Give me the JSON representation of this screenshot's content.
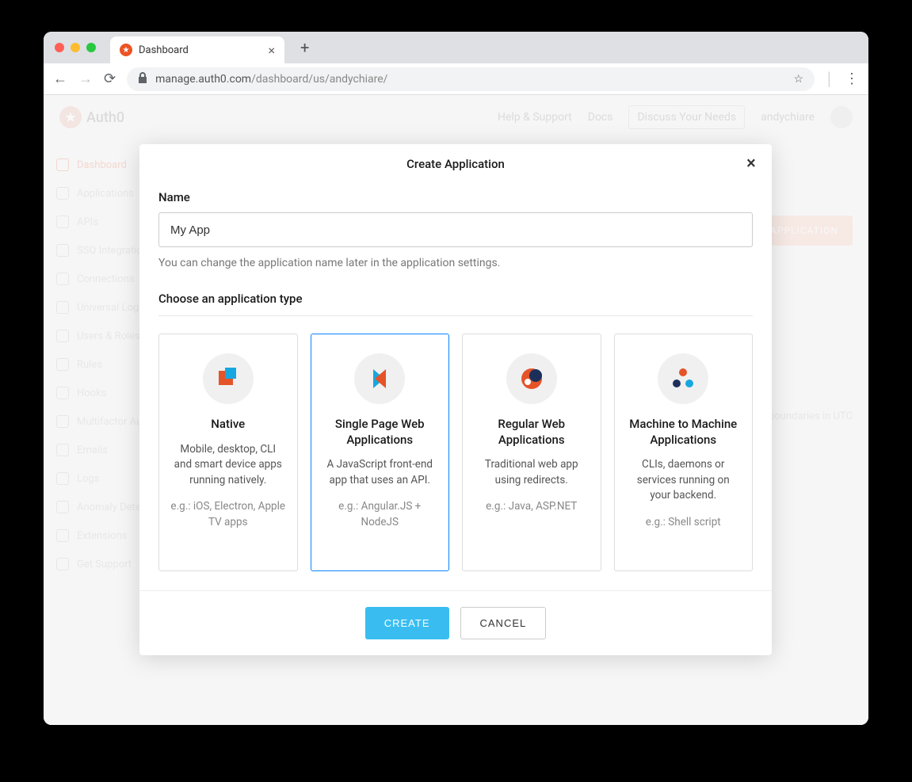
{
  "browser": {
    "tab_title": "Dashboard",
    "url_host": "manage.auth0.com",
    "url_path": "/dashboard/us/andychiare/"
  },
  "bg": {
    "brand": "Auth0",
    "nav": {
      "help": "Help & Support",
      "docs": "Docs",
      "discuss": "Discuss Your Needs",
      "user": "andychiare"
    },
    "sidebar": [
      "Dashboard",
      "Applications",
      "APIs",
      "SSO Integrations",
      "Connections",
      "Universal Login",
      "Users & Roles",
      "Rules",
      "Hooks",
      "Multifactor Auth",
      "Emails",
      "Logs",
      "Anomaly Detection",
      "Extensions",
      "Get Support"
    ],
    "create_app_btn": "+ CREATE APPLICATION",
    "utc_note": "boundaries in UTC"
  },
  "modal": {
    "title": "Create Application",
    "name_label": "Name",
    "name_value": "My App",
    "name_hint": "You can change the application name later in the application settings.",
    "type_label": "Choose an application type",
    "cards": [
      {
        "title": "Native",
        "desc": "Mobile, desktop, CLI and smart device apps running natively.",
        "eg": "e.g.: iOS, Electron, Apple TV apps",
        "selected": false
      },
      {
        "title": "Single Page Web Applications",
        "desc": "A JavaScript front-end app that uses an API.",
        "eg": "e.g.: Angular.JS + NodeJS",
        "selected": true
      },
      {
        "title": "Regular Web Applications",
        "desc": "Traditional web app using redirects.",
        "eg": "e.g.: Java, ASP.NET",
        "selected": false
      },
      {
        "title": "Machine to Machine Applications",
        "desc": "CLIs, daemons or services running on your backend.",
        "eg": "e.g.: Shell script",
        "selected": false
      }
    ],
    "create_btn": "CREATE",
    "cancel_btn": "CANCEL"
  }
}
